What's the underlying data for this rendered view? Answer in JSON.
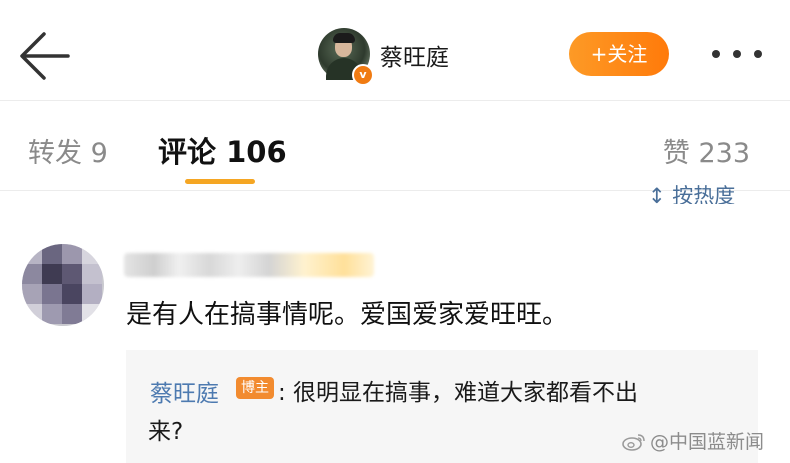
{
  "header": {
    "back_icon": "arrow-left-icon",
    "author_name": "蔡旺庭",
    "verified_badge": "v",
    "follow_label": "+关注",
    "more_icon": "more-dots-icon"
  },
  "tabs": {
    "repost": "转发 9",
    "comment": "评论 106",
    "like": "赞 233",
    "active_color": "#f5a623"
  },
  "sort": {
    "label": "↕ 按热度"
  },
  "comment": {
    "text": "是有人在搞事情呢。爱国爱家爱旺旺。"
  },
  "reply": {
    "author": "蔡旺庭",
    "badge": "博主",
    "text_line1": ": 很明显在搞事，难道大家都看不出",
    "text_line2": "来?"
  },
  "watermark": {
    "text": "@中国蓝新闻"
  },
  "colors": {
    "accent_orange": "#ff8a1a",
    "link_blue": "#4d7ab0"
  }
}
